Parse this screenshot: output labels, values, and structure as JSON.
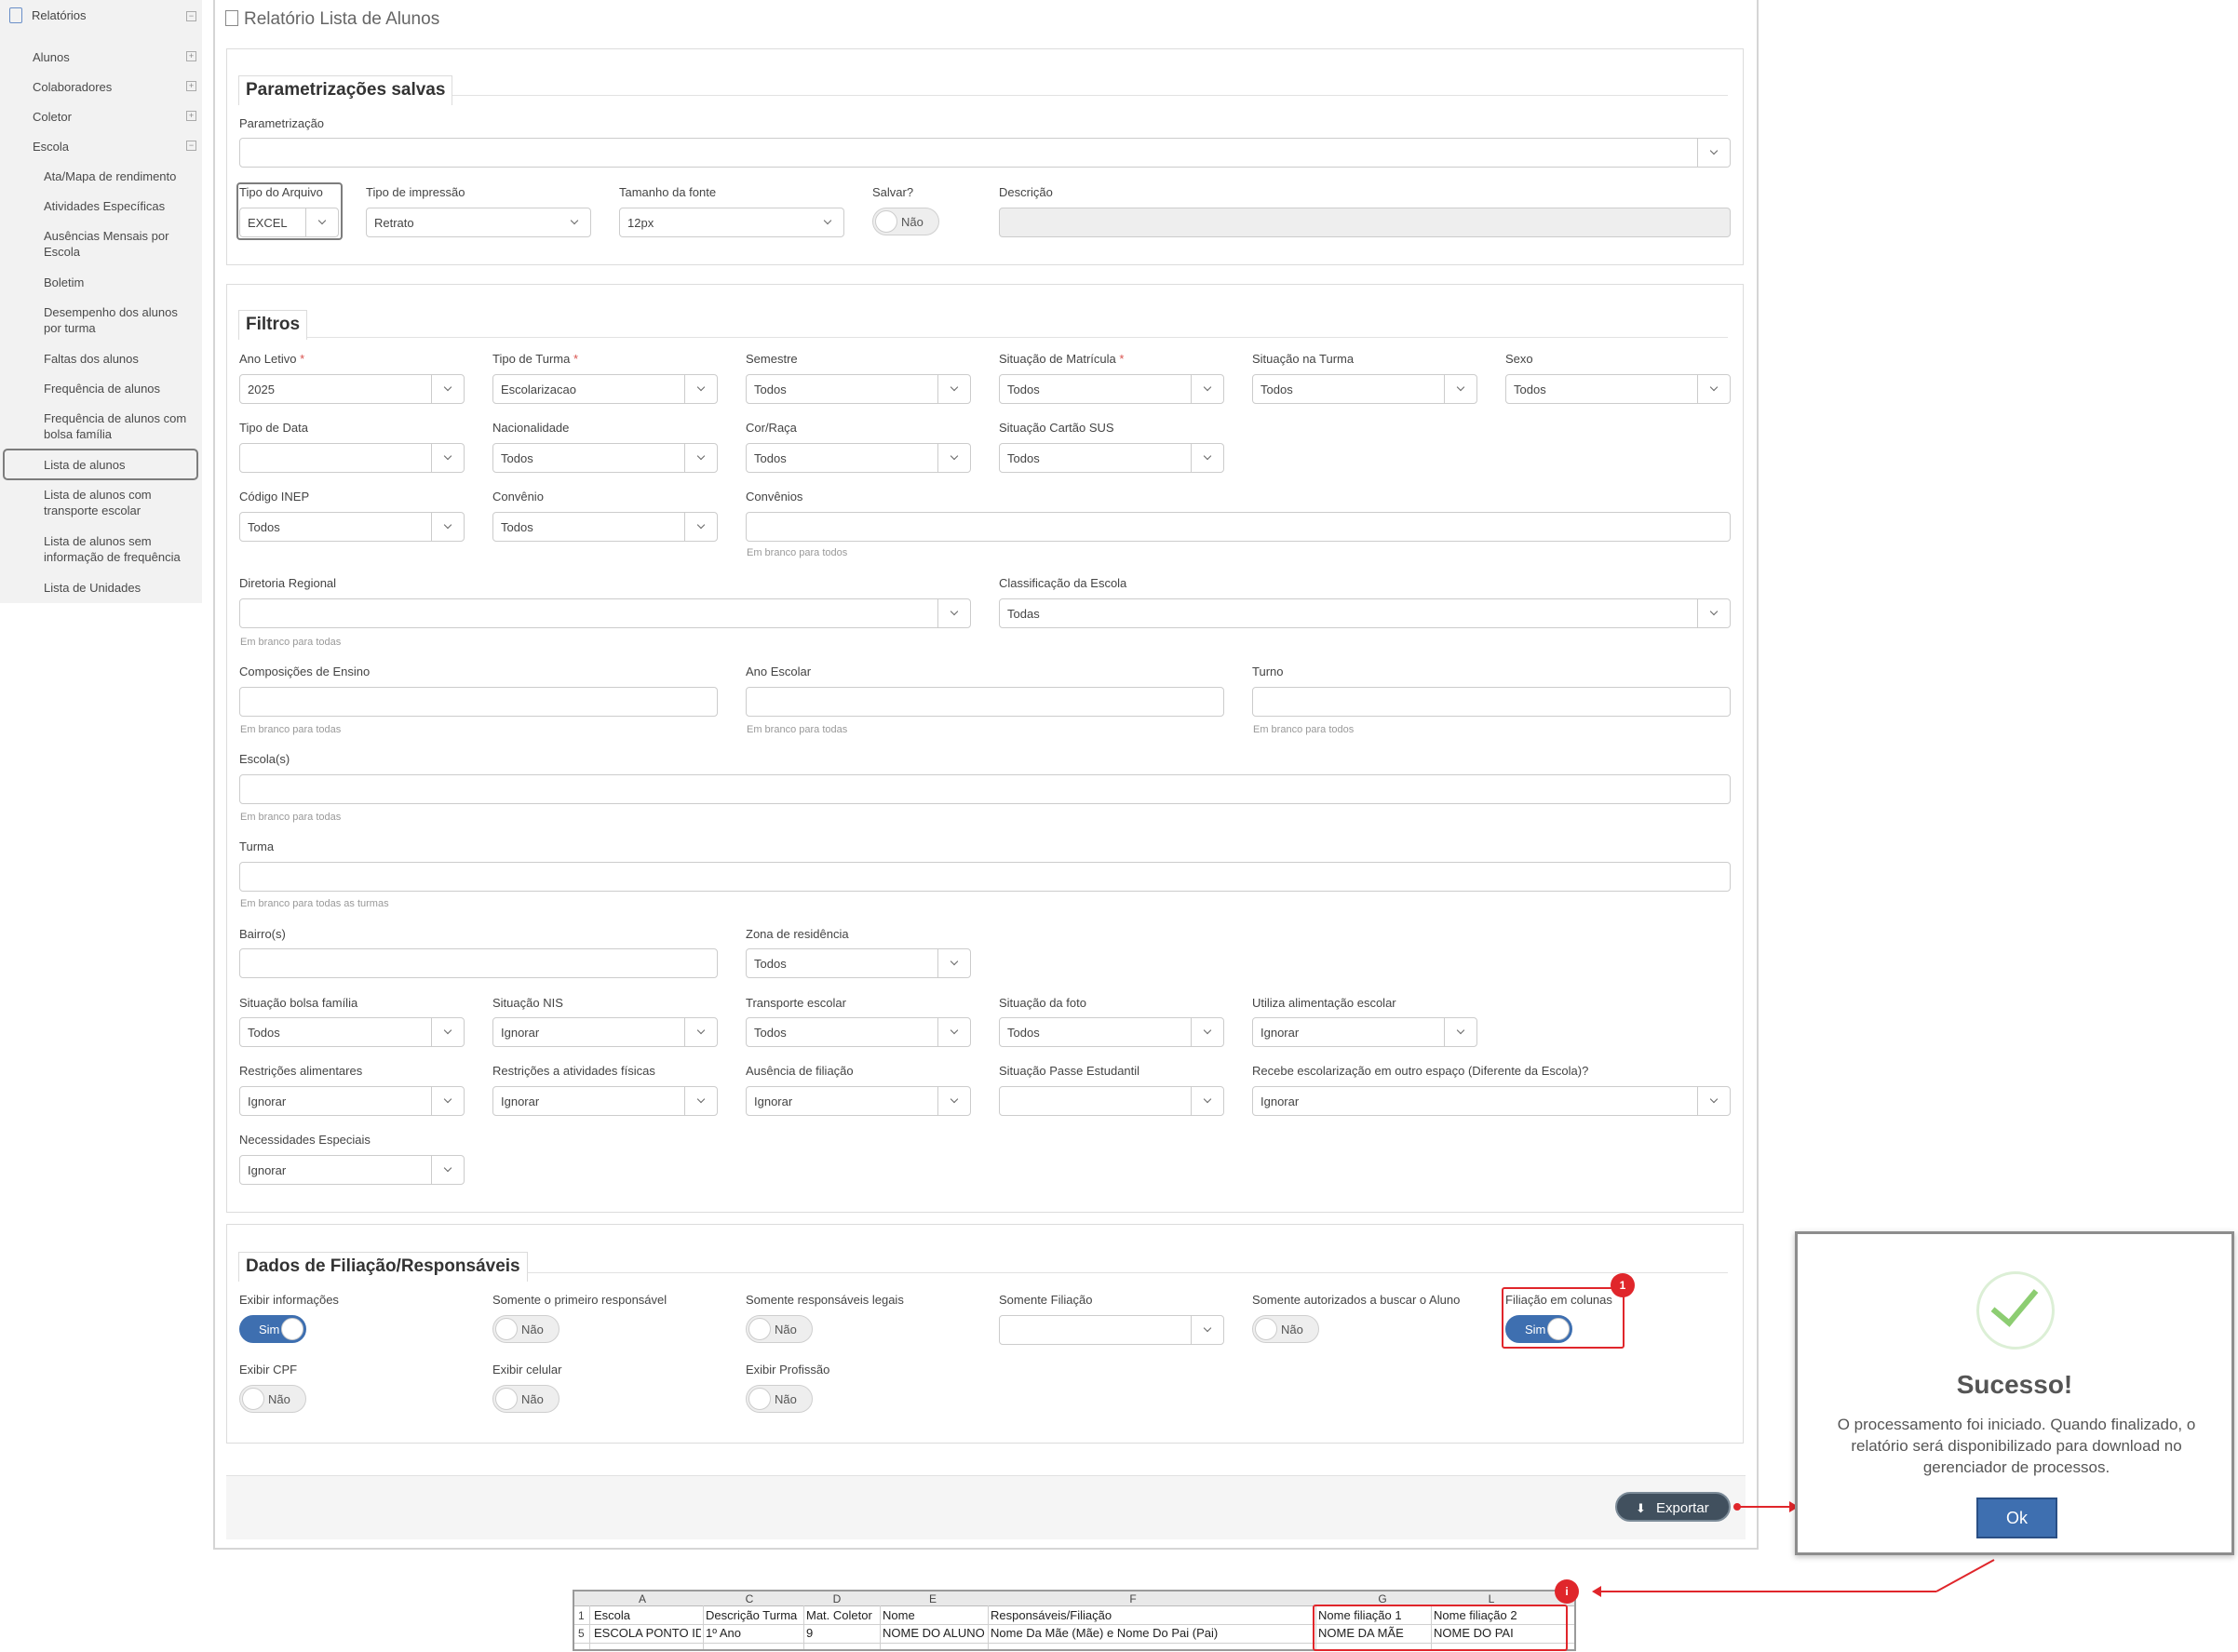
{
  "sidebar": {
    "root": "Relatórios",
    "groups": [
      "Alunos",
      "Colaboradores",
      "Coletor",
      "Escola"
    ],
    "escola_items": [
      "Ata/Mapa de rendimento",
      "Atividades Específicas",
      "Ausências Mensais por Escola",
      "Boletim",
      "Desempenho dos alunos por turma",
      "Faltas dos alunos",
      "Frequência de alunos",
      "Frequência de alunos com bolsa família",
      "Lista de alunos",
      "Lista de alunos com transporte escolar",
      "Lista de alunos sem informação de frequência",
      "Lista de Unidades"
    ]
  },
  "page": {
    "title": "Relatório Lista de Alunos"
  },
  "param": {
    "legend": "Parametrizações salvas",
    "parametrizacao_label": "Parametrização",
    "tipo_arquivo_label": "Tipo do Arquivo",
    "tipo_arquivo": "EXCEL",
    "tipo_impressao_label": "Tipo de impressão",
    "tipo_impressao": "Retrato",
    "tamanho_fonte_label": "Tamanho da fonte",
    "tamanho_fonte": "12px",
    "salvar_label": "Salvar?",
    "salvar": "Não",
    "descricao_label": "Descrição"
  },
  "filtros": {
    "legend": "Filtros",
    "ano_letivo_label": "Ano Letivo",
    "ano_letivo": "2025",
    "tipo_turma_label": "Tipo de Turma",
    "tipo_turma": "Escolarizacao",
    "semestre_label": "Semestre",
    "semestre": "Todos",
    "sit_matricula_label": "Situação de Matrícula",
    "sit_matricula": "Todos",
    "sit_turma_label": "Situação na Turma",
    "sit_turma": "Todos",
    "sexo_label": "Sexo",
    "sexo": "Todos",
    "tipo_data_label": "Tipo de Data",
    "nacionalidade_label": "Nacionalidade",
    "nacionalidade": "Todos",
    "cor_raca_label": "Cor/Raça",
    "cor_raca": "Todos",
    "cartao_sus_label": "Situação Cartão SUS",
    "cartao_sus": "Todos",
    "codigo_inep_label": "Código INEP",
    "codigo_inep": "Todos",
    "convenio_label": "Convênio",
    "convenio": "Todos",
    "convenios_label": "Convênios",
    "convenios_hint": "Em branco para todos",
    "diretoria_label": "Diretoria Regional",
    "diretoria_hint": "Em branco para todas",
    "classificacao_label": "Classificação da Escola",
    "classificacao": "Todas",
    "composicoes_label": "Composições de Ensino",
    "composicoes_hint": "Em branco para todas",
    "ano_escolar_label": "Ano Escolar",
    "ano_escolar_hint": "Em branco para todas",
    "turno_label": "Turno",
    "turno_hint": "Em branco para todos",
    "escolas_label": "Escola(s)",
    "escolas_hint": "Em branco para todas",
    "turma_label": "Turma",
    "turma_hint": "Em branco para todas as turmas",
    "bairros_label": "Bairro(s)",
    "zona_label": "Zona de residência",
    "zona": "Todos",
    "bolsa_label": "Situação bolsa família",
    "bolsa": "Todos",
    "nis_label": "Situação NIS",
    "nis": "Ignorar",
    "transporte_label": "Transporte escolar",
    "transporte": "Todos",
    "foto_label": "Situação da foto",
    "foto": "Todos",
    "alimentacao_label": "Utiliza alimentação escolar",
    "alimentacao": "Ignorar",
    "restricoes_alim_label": "Restrições alimentares",
    "restricoes_alim": "Ignorar",
    "restricoes_fis_label": "Restrições a atividades físicas",
    "restricoes_fis": "Ignorar",
    "ausencia_fil_label": "Ausência de filiação",
    "ausencia_fil": "Ignorar",
    "passe_label": "Situação Passe Estudantil",
    "outro_espaco_label": "Recebe escolarização em outro espaço (Diferente da Escola)?",
    "outro_espaco": "Ignorar",
    "necessidades_label": "Necessidades Especiais",
    "necessidades": "Ignorar"
  },
  "filiacao": {
    "legend": "Dados de Filiação/Responsáveis",
    "exibir_info_label": "Exibir informações",
    "exibir_info": "Sim",
    "primeiro_resp_label": "Somente o primeiro responsável",
    "primeiro_resp": "Não",
    "resp_legais_label": "Somente responsáveis legais",
    "resp_legais": "Não",
    "somente_filiacao_label": "Somente Filiação",
    "autorizados_label": "Somente autorizados a buscar o Aluno",
    "autorizados": "Não",
    "colunas_label": "Filiação em colunas",
    "colunas": "Sim",
    "cpf_label": "Exibir CPF",
    "cpf": "Não",
    "celular_label": "Exibir celular",
    "celular": "Não",
    "profissao_label": "Exibir Profissão",
    "profissao": "Não",
    "badge": "1"
  },
  "export": {
    "label": "Exportar"
  },
  "modal": {
    "title": "Sucesso!",
    "message": "O processamento foi iniciado. Quando finalizado, o relatório será disponibilizado para download no gerenciador de processos.",
    "ok": "Ok"
  },
  "sheet": {
    "badge": "i",
    "columns": [
      "A",
      "C",
      "D",
      "E",
      "F",
      "G",
      "L"
    ],
    "row_numbers": [
      "1",
      "5"
    ],
    "header_row": [
      "Escola",
      "Descrição Turma",
      "Mat. Coletor",
      "Nome",
      "Responsáveis/Filiação",
      "Nome filiação 1",
      "Nome filiação 2"
    ],
    "data_row": [
      "ESCOLA PONTO ID",
      "1º Ano",
      "9",
      "NOME DO ALUNO",
      "Nome Da Mãe (Mãe) e Nome Do Pai (Pai)",
      "NOME DA MÃE",
      "NOME DO PAI"
    ]
  },
  "colors": {
    "accent": "#3e6fb0",
    "highlight": "#e0262b",
    "export_button": "#41505e",
    "success": "#8dcd72"
  }
}
